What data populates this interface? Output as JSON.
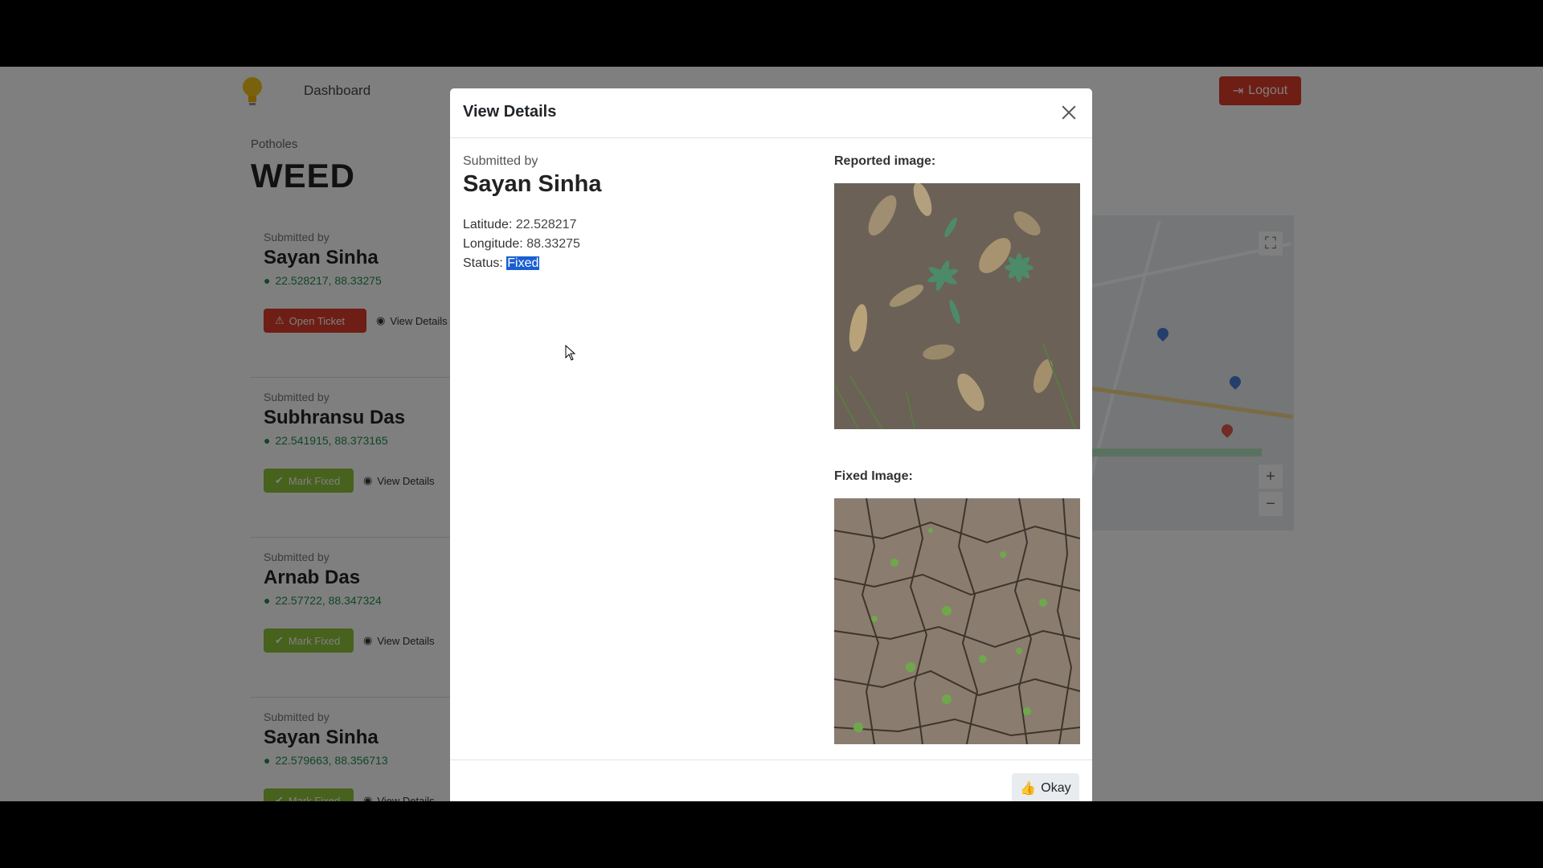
{
  "nav": {
    "dashboard_label": "Dashboard",
    "logout_label": "Logout",
    "brand_color": "#f5c518"
  },
  "page": {
    "breadcrumb": "Potholes",
    "title": "WEED"
  },
  "cards": [
    {
      "submitted_label": "Submitted by",
      "name": "Sayan Sinha",
      "coords": "22.528217, 88.33275",
      "primary_button": "Open Ticket",
      "primary_color": "#dc3c2a",
      "secondary_button": "View Details"
    },
    {
      "submitted_label": "Submitted by",
      "name": "Subhransu Das",
      "coords": "22.541915, 88.373165",
      "primary_button": "Mark Fixed",
      "primary_color": "#8fc43a",
      "secondary_button": "View Details"
    },
    {
      "submitted_label": "Submitted by",
      "name": "Arnab Das",
      "coords": "22.57722, 88.347324",
      "primary_button": "Mark Fixed",
      "primary_color": "#8fc43a",
      "secondary_button": "View Details"
    },
    {
      "submitted_label": "Submitted by",
      "name": "Sayan Sinha",
      "coords": "22.579663, 88.356713",
      "primary_button": "Mark Fixed",
      "primary_color": "#8fc43a",
      "secondary_button": "View Details"
    }
  ],
  "modal": {
    "title": "View Details",
    "submitted_label": "Submitted by",
    "submitter_name": "Sayan Sinha",
    "latitude_label": "Latitude:",
    "latitude_value": "22.528217",
    "longitude_label": "Longitude:",
    "longitude_value": "88.33275",
    "status_label": "Status:",
    "status_value": "Fixed",
    "reported_image_label": "Reported image:",
    "fixed_image_label": "Fixed Image:",
    "okay_label": "Okay"
  },
  "colors": {
    "danger": "#dc3c2a",
    "success": "#8fc43a",
    "link_green": "#1e8f4e",
    "selection": "#1a5fd1"
  }
}
